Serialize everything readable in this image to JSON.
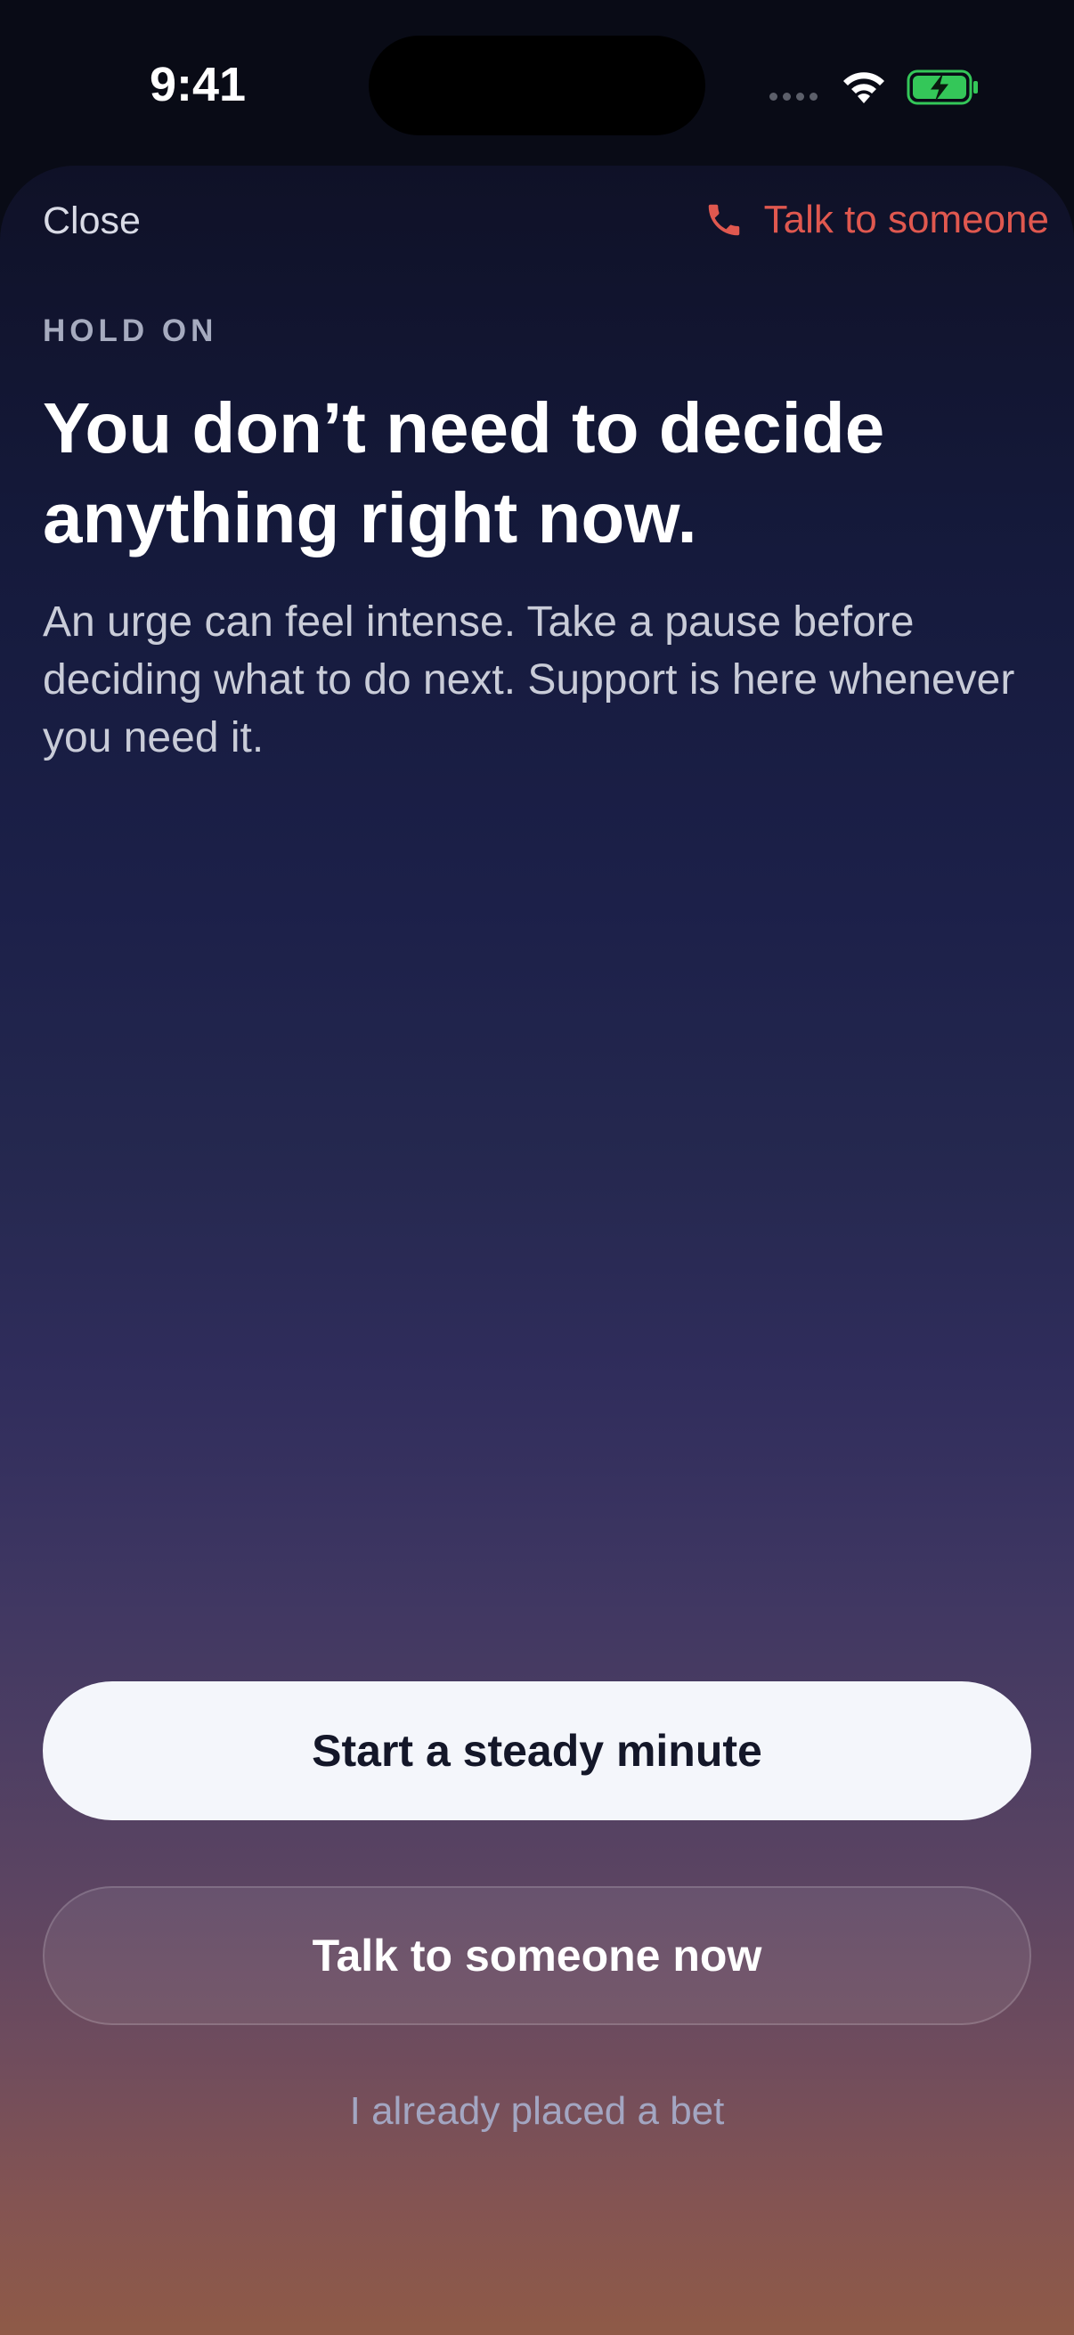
{
  "status_bar": {
    "time": "9:41",
    "icons": [
      "cellular-signal-icon",
      "wifi-icon",
      "battery-charging-icon"
    ]
  },
  "header": {
    "close_label": "Close",
    "talk_label": "Talk to someone",
    "talk_icon": "phone-icon"
  },
  "content": {
    "eyebrow": "HOLD ON",
    "headline": "You don’t need to decide anything right now.",
    "body": "An urge can feel intense. Take a pause before deciding what to do next. Support is here whenever you need it."
  },
  "actions": {
    "primary_label": "Start a steady minute",
    "secondary_label": "Talk to someone now",
    "tertiary_label": "I already placed a bet"
  },
  "colors": {
    "accent": "#e0584f",
    "background_top": "#0f1127",
    "background_bottom": "#8f5a47",
    "battery_fill": "#34c759"
  }
}
